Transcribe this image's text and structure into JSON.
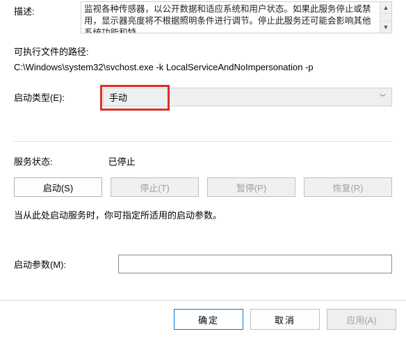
{
  "desc_label": "描述:",
  "desc_text": "监视各种传感器，以公开数据和适应系统和用户状态。如果此服务停止或禁用，显示器亮度将不根据照明条件进行调节。停止此服务还可能会影响其他系统功能和特",
  "path_label": "可执行文件的路径:",
  "path_value": "C:\\Windows\\system32\\svchost.exe -k LocalServiceAndNoImpersonation -p",
  "startup_label": "启动类型(E):",
  "startup_value": "手动",
  "status_label": "服务状态:",
  "status_value": "已停止",
  "btn_start": "启动(S)",
  "btn_stop": "停止(T)",
  "btn_pause": "暂停(P)",
  "btn_resume": "恢复(R)",
  "hint": "当从此处启动服务时，你可指定所适用的启动参数。",
  "param_label": "启动参数(M):",
  "param_value": "",
  "footer_ok": "确定",
  "footer_cancel": "取消",
  "footer_apply": "应用(A)"
}
